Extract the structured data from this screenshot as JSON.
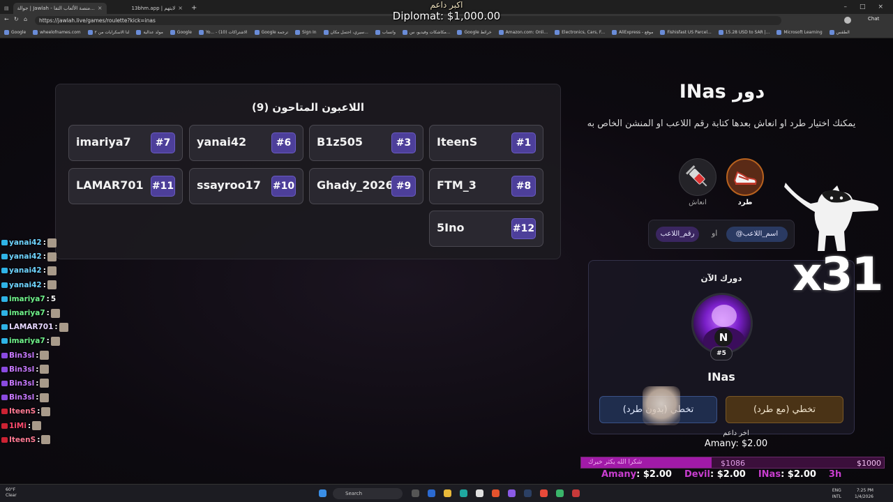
{
  "browser": {
    "tabs": [
      {
        "label": "جوالة | Jawlah - منصة الألعاب التفا..."
      },
      {
        "label": "13bhm.app | لايتهم"
      },
      {
        "label": "+"
      }
    ],
    "url": "https://jawlah.live/games/roulette?kick=inas",
    "bookmarks": [
      "Google",
      "wheelofnames.com",
      "لنا الاسكرابات من ٢",
      "مولد عدالية",
      "Google",
      "Yo... - الاشتراكات (10)",
      "Google ترجمة",
      "Sign In",
      "سيري، احتمل مكان...",
      "واتساب",
      "مكاشكات وفيديو، س...",
      "Google خرائط",
      "Amazon.com: Onli...",
      "Electronics, Cars, F...",
      "AliExpress - موقع",
      "Fishisfast US Parcel...",
      "15.28 USD to SAR |...",
      "Microsoft Learning",
      "الطقس"
    ],
    "chat_button": "Chat"
  },
  "top_overlay": {
    "label": "اكبر داعم",
    "donor": "Diplomat: $1,000.00"
  },
  "players": {
    "title": "اللاعبون المتاحون (9)",
    "list": [
      {
        "name": "IteenS",
        "num": "#1"
      },
      {
        "name": "B1z505",
        "num": "#3"
      },
      {
        "name": "yanai42",
        "num": "#6"
      },
      {
        "name": "imariya7",
        "num": "#7"
      },
      {
        "name": "FTM_3",
        "num": "#8"
      },
      {
        "name": "Ghady_2026",
        "num": "#9"
      },
      {
        "name": "ssayroo17",
        "num": "#10"
      },
      {
        "name": "LAMAR701",
        "num": "#11"
      },
      {
        "name": "5Ino",
        "num": "#12"
      }
    ]
  },
  "turn": {
    "title": "دور INas",
    "description": "يمكنك اختيار طرد او انعاش بعدها كتابة رقم اللاعب او المنشن الخاص به",
    "kick_label": "طرد",
    "revive_label": "انعاش",
    "mention_pill": "@اسم_اللاعب",
    "or_word": "او",
    "number_pill": "رقم_اللاعب"
  },
  "current": {
    "label": "دورك الآن",
    "avatar_letter": "N",
    "badge": "#5",
    "name": "INas",
    "btn_with_kick": "تخطي (مع طرد)",
    "btn_without_kick": "تخطي (بدون طرد)"
  },
  "chat": [
    {
      "user": "yanai42",
      "text": "",
      "color": "#6fd4ff"
    },
    {
      "user": "yanai42",
      "text": "",
      "color": "#6fd4ff"
    },
    {
      "user": "yanai42",
      "text": "",
      "color": "#6fd4ff"
    },
    {
      "user": "yanai42",
      "text": "",
      "color": "#6fd4ff"
    },
    {
      "user": "imariya7",
      "text": "5",
      "color": "#6ff28a"
    },
    {
      "user": "imariya7",
      "text": "",
      "color": "#6ff28a"
    },
    {
      "user": "LAMAR701",
      "text": "",
      "color": "#e6d6ff"
    },
    {
      "user": "imariya7",
      "text": "",
      "color": "#6ff28a"
    },
    {
      "user": "Bin3sl",
      "text": "",
      "color": "#c779ff"
    },
    {
      "user": "Bin3sl",
      "text": "",
      "color": "#c779ff"
    },
    {
      "user": "Bin3sl",
      "text": "",
      "color": "#c779ff"
    },
    {
      "user": "Bin3sl",
      "text": "",
      "color": "#c779ff"
    },
    {
      "user": "IteenS",
      "text": "",
      "color": "#ff7a93"
    },
    {
      "user": "1iMi",
      "text": "",
      "color": "#ff4b6e"
    },
    {
      "user": "IteenS",
      "text": "",
      "color": "#ff7a93"
    }
  ],
  "multiplier": "x31",
  "last_donor": {
    "label": "اخر داعم",
    "donor": "Amany: $2.00"
  },
  "goal": {
    "text": "شكرا الله يكثر خيرك",
    "current": "$1086",
    "target": "$1000",
    "fill_percent": 43
  },
  "top_donors": [
    {
      "name": "Amany",
      "amount": ": $2.00"
    },
    {
      "name": "Devil",
      "amount": ": $2.00"
    },
    {
      "name": "INas",
      "amount": ": $2.00"
    },
    {
      "name": "3h",
      "amount": ""
    }
  ],
  "taskbar": {
    "weather_temp": "60°F",
    "weather_desc": "Clear",
    "search": "Search",
    "lang1": "ENG",
    "lang2": "INTL",
    "time": "7:25 PM",
    "date": "1/4/2026"
  },
  "colors": {
    "accent_purple": "#4d3f9a",
    "kick_orange": "#b8621e",
    "goal_magenta": "#a11aa8"
  }
}
